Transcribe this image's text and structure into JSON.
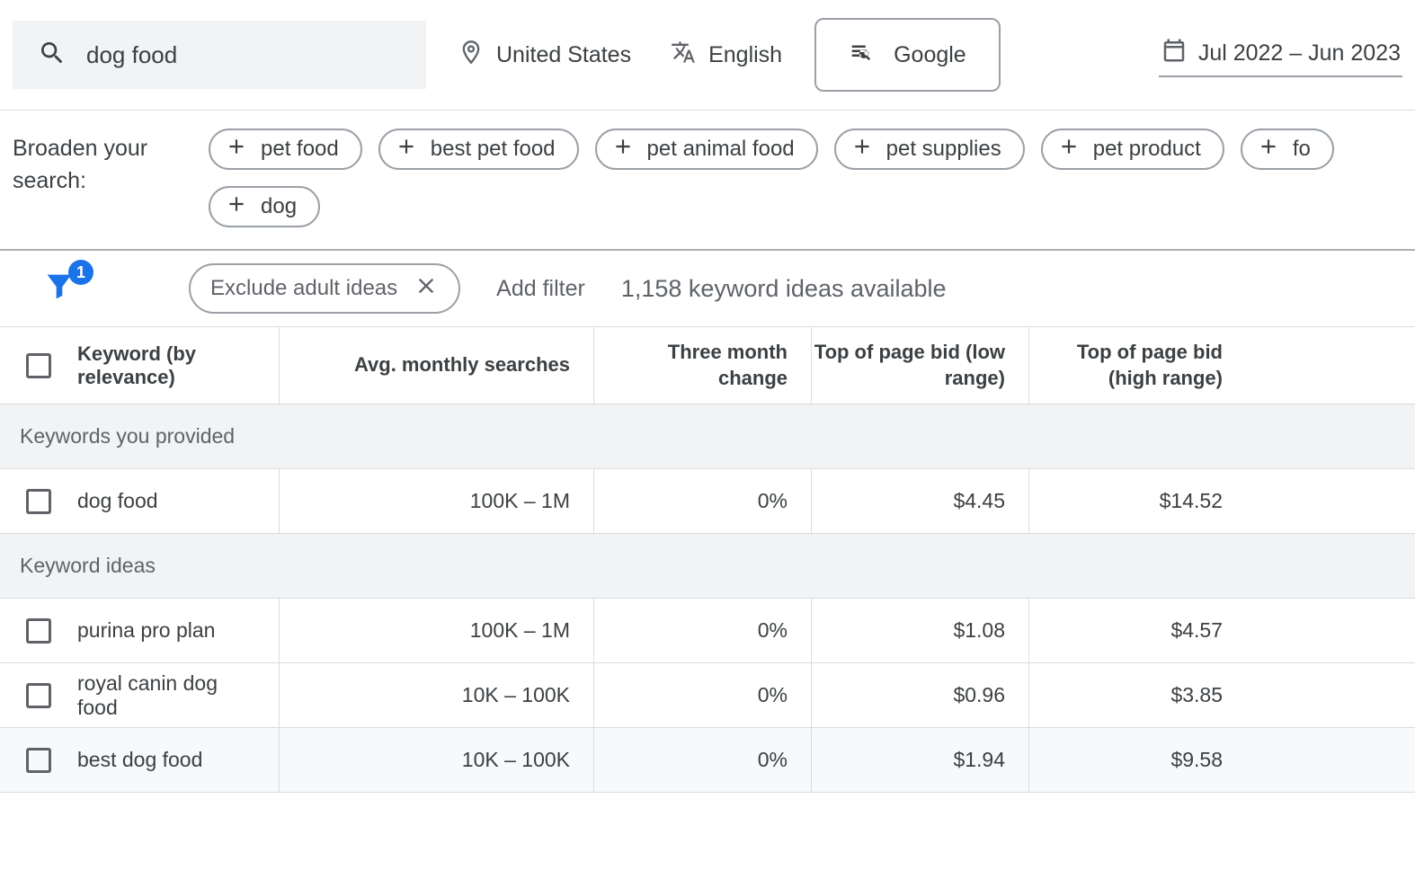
{
  "search": {
    "value": "dog food"
  },
  "location": "United States",
  "language": "English",
  "network": "Google",
  "date_range": "Jul 2022 – Jun 2023",
  "broaden": {
    "label": "Broaden your search:",
    "items": [
      "pet food",
      "best pet food",
      "pet animal food",
      "pet supplies",
      "pet product",
      "fo",
      "dog"
    ]
  },
  "filter": {
    "badge": "1",
    "applied": "Exclude adult ideas",
    "add": "Add filter",
    "count": "1,158 keyword ideas available"
  },
  "table": {
    "headers": {
      "keyword": "Keyword (by relevance)",
      "avg": "Avg. monthly searches",
      "threeMonth": "Three month change",
      "low": "Top of page bid (low range)",
      "high": "Top of page bid (high range)"
    },
    "section_provided": "Keywords you provided",
    "section_ideas": "Keyword ideas",
    "rows_provided": [
      {
        "kw": "dog food",
        "avg": "100K – 1M",
        "tm": "0%",
        "low": "$4.45",
        "high": "$14.52"
      }
    ],
    "rows_ideas": [
      {
        "kw": "purina pro plan",
        "avg": "100K – 1M",
        "tm": "0%",
        "low": "$1.08",
        "high": "$4.57"
      },
      {
        "kw": "royal canin dog food",
        "avg": "10K – 100K",
        "tm": "0%",
        "low": "$0.96",
        "high": "$3.85"
      },
      {
        "kw": "best dog food",
        "avg": "10K – 100K",
        "tm": "0%",
        "low": "$1.94",
        "high": "$9.58"
      }
    ]
  }
}
